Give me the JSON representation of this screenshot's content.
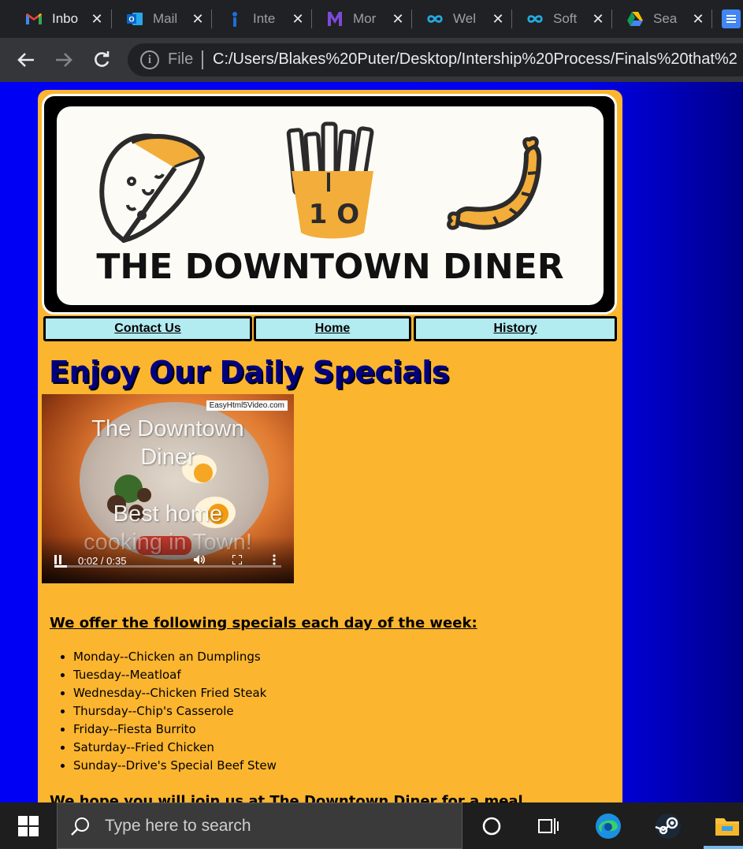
{
  "browser": {
    "tabs": [
      {
        "label": "Inbo",
        "icon": "gmail-icon",
        "active": true
      },
      {
        "label": "Mail",
        "icon": "outlook-icon",
        "active": false
      },
      {
        "label": "Inte",
        "icon": "info-i-icon",
        "active": false
      },
      {
        "label": "Mor",
        "icon": "m-logo-icon",
        "active": false
      },
      {
        "label": "Wel",
        "icon": "link-loop-icon",
        "active": false
      },
      {
        "label": "Soft",
        "icon": "link-loop-icon",
        "active": false
      },
      {
        "label": "Sea",
        "icon": "google-drive-icon",
        "active": false
      }
    ],
    "address": {
      "scheme_label": "File",
      "url": "C:/Users/Blakes%20Puter/Desktop/Intership%20Process/Finals%20that%2"
    }
  },
  "page": {
    "banner": {
      "title": "THE DOWNTOWN DINER",
      "icons": [
        "taco-icon",
        "fries-icon",
        "sausage-icon"
      ]
    },
    "nav": [
      {
        "label": "Contact Us"
      },
      {
        "label": "Home"
      },
      {
        "label": "History"
      }
    ],
    "specials_title": "Enjoy Our Daily Specials",
    "video": {
      "watermark": "EasyHtml5Video.com",
      "overlay_line1": "The Downtown",
      "overlay_line2": "Diner",
      "overlay_line3": "Best home",
      "overlay_line4": "cooking in Town!",
      "time": "0:02 / 0:35",
      "progress_fraction": 0.057
    },
    "offer_heading": "We offer the following specials each day of the week:",
    "specials": [
      "Monday--Chicken an Dumplings",
      "Tuesday--Meatloaf",
      "Wednesday--Chicken Fried Steak",
      "Thursday--Chip's Casserole",
      "Friday--Fiesta Burrito",
      "Saturday--Fried Chicken",
      "Sunday--Drive's Special Beef Stew"
    ],
    "join_heading": "We hope you will join us at The Downtown Diner for a meal."
  },
  "taskbar": {
    "search_placeholder": "Type here to search"
  },
  "colors": {
    "page_background": "#0000f5",
    "container": "#fbb52f",
    "nav_button": "#b2ebf0",
    "title_text": "#000080"
  }
}
